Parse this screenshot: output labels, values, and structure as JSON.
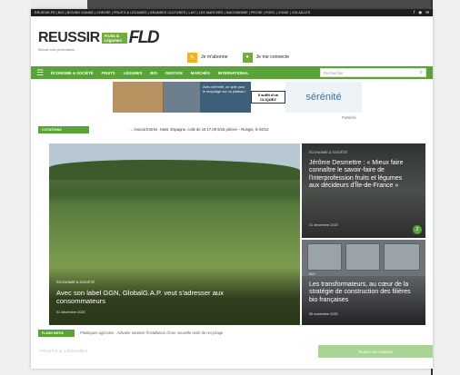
{
  "topbar": {
    "links": "REUSSIR.FR | BIO | BOVINS VIANDE | CHÈVRE | FRUITS & LÉGUMES | GRANDES CULTURES | LAIT | LES MARCHÉS | MACHINISME | PÊCHE | PORC | VIGNE | VOLAILLES",
    "icons": [
      "facebook-icon",
      "rss-icon",
      "mail-icon"
    ]
  },
  "header": {
    "logo_word": "REUSSIR",
    "logo_tag": "Fruits & Légumes",
    "logo_fd": "FLD",
    "tagline": "Réussir votre performance",
    "subscribe_label": "Je m'abonne",
    "login_label": "Je me connecte"
  },
  "nav": {
    "items": [
      "ÉCONOMIE & SOCIÉTÉ",
      "FRUITS",
      "LÉGUMES",
      "BIO",
      "GESTION",
      "MARCHÉS",
      "INTERNATIONAL"
    ],
    "search_placeholder": "Rechercher"
  },
  "banner": {
    "message": "Avec sérénité, on opte pour le recyclage sur un plateau !",
    "stamp": "Il suffit d'un CLIQUEZ",
    "brand": "sérénité",
    "pub_label": "Publicité"
  },
  "ticker": {
    "tag": "COTATIONS",
    "text": "→ Avocat Entrée, Hass, Espagne, colis de 16 17,00 6/16 pièces – Rungis, le 04/12"
  },
  "hero": {
    "category": "ÉCONOMIE & SOCIÉTÉ",
    "title": "Avec son label GGN, GlobalG.A.P. veut s'adresser aux consommateurs",
    "date": "01 décembre 2020"
  },
  "side1": {
    "category": "ÉCONOMIE & SOCIÉTÉ",
    "title": "Jérôme Desmettre : « Mieux faire connaître le savoir-faire de l'interprofession fruits et légumes aux décideurs d'Île-de-France »",
    "date": "01 décembre 2020",
    "badge": "2"
  },
  "side2": {
    "category": "BIO",
    "title": "Les transformateurs, au cœur de la stratégie de construction des filières bio françaises",
    "date": "30 novembre 2020"
  },
  "flash": {
    "tag": "FLASH INFOS",
    "text": "Plastiques agricoles : Adivalor soutient l'installation d'une nouvelle unité de recyclage"
  },
  "bottom": {
    "heading": "FRUITS & LÉGUMES",
    "cta_label": "Toutes nos cotations"
  },
  "colors": {
    "accent_green": "#5aa33a",
    "subscribe_yellow": "#f0b423",
    "topbar_dark": "#1e1e1e"
  }
}
